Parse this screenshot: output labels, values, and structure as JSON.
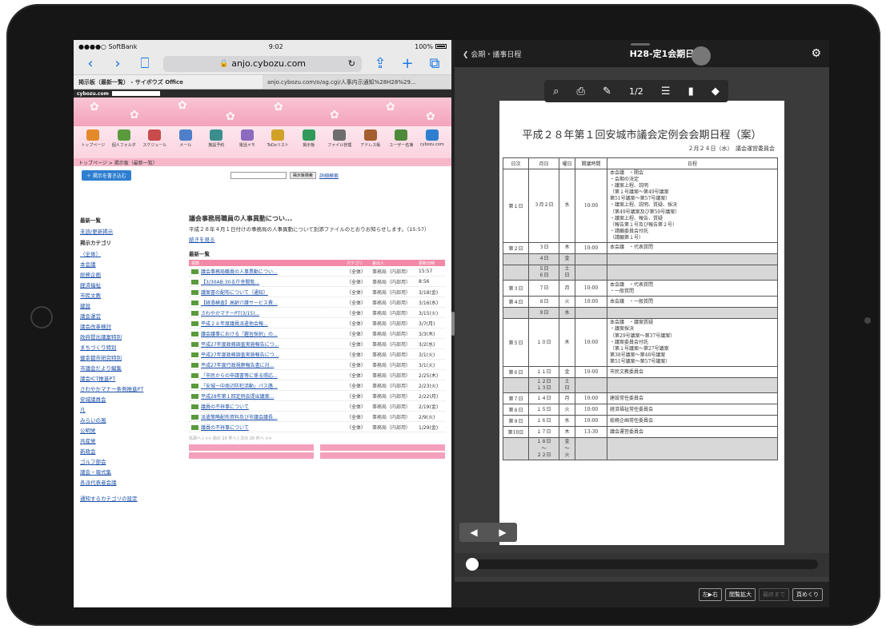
{
  "status": {
    "carrier": "●●●●○ SoftBank",
    "time": "9:02",
    "battery": "100%"
  },
  "safari": {
    "url": "anjo.cybozu.com",
    "tabs": [
      "掲示板（最新一覧） - サイボウズ Office",
      "anjo.cybozu.com/o/ag.cgi/人事内示通知%28H28%29..."
    ]
  },
  "cybozu": {
    "brand": "cybozu.com",
    "apps": [
      "トップページ",
      "個人フォルダ",
      "スケジュール",
      "メール",
      "施設予約",
      "電話メモ",
      "ToDoリスト",
      "掲示板",
      "ファイル管理",
      "アドレス帳",
      "ユーザー名簿",
      "cybozu.com"
    ],
    "breadcrumb": "トップページ > 掲示板（最新一覧）",
    "write_button": "＋ 掲示を書き込む",
    "search_button": "掲示板検索",
    "search_link": "詳細検索",
    "sidebar": {
      "head1": "最新一覧",
      "item1": "未読/更新掲示",
      "head2": "掲示カテゴリ",
      "items": [
        "（全体）",
        "本会議",
        "総務企画",
        "経済福祉",
        "市民文教",
        "建設",
        "議会運営",
        "議会改革検討",
        "政府提出議案特別",
        "まちづくり特別",
        "健幸都市研究特別",
        "市議会だより編集",
        "議会ICT推進PT",
        "さわやかマナー条例推進PT",
        "安城議員会",
        "凡",
        "みらいの風",
        "公明党",
        "共産党",
        "新政会",
        "ゴルフ部会",
        "議会・報式集",
        "各派代表者会議"
      ],
      "footer": "通知するカテゴリの設定"
    },
    "main": {
      "title": "議会事務局職員の人事異動につい...",
      "body": "平成２８年４月１日付けの事務局の人事異動について別添ファイルのとおりお知らせします。（15:57）",
      "more": "続きを見る",
      "list_title": "最新一覧",
      "headers": [
        "標題",
        "カテゴリ",
        "差出人",
        "更新日時"
      ],
      "rows": [
        {
          "t": "議会事務局職員の人事異動につい...",
          "c": "（全体）",
          "s": "事務局（内部用）",
          "d": "15:57"
        },
        {
          "t": "【3/30AB:30る庁舎閲覧...",
          "c": "（全体）",
          "s": "事務局（内部用）",
          "d": "8:56"
        },
        {
          "t": "議案書の配布について（通知）",
          "c": "（全体）",
          "s": "事務局（内部用）",
          "d": "3/18(金)"
        },
        {
          "t": "【経過検査】高齢介護サービス費...",
          "c": "（全体）",
          "s": "事務局（内部用）",
          "d": "3/16(水)"
        },
        {
          "t": "さわやかマナーPT(3/15)...",
          "c": "（全体）",
          "s": "事務局（内部用）",
          "d": "3/15(火)"
        },
        {
          "t": "平成２８年度議員派遣他会報...",
          "c": "（全体）",
          "s": "事務局（内部用）",
          "d": "3/7(月)"
        },
        {
          "t": "議会議事における「趣旨採択」の...",
          "c": "（全体）",
          "s": "事務局（内部用）",
          "d": "3/3(木)"
        },
        {
          "t": "平成27年度政務調査実施報告につ...",
          "c": "（全体）",
          "s": "事務局（内部用）",
          "d": "3/2(水)"
        },
        {
          "t": "平成27年度政務調査実施報告につ...",
          "c": "（全体）",
          "s": "事務局（内部用）",
          "d": "3/1(火)"
        },
        {
          "t": "平成27年度行政視察報告書に対...",
          "c": "（全体）",
          "s": "事務局（内部用）",
          "d": "3/1(火)"
        },
        {
          "t": "「市民からの申請書等に係る照応...",
          "c": "（全体）",
          "s": "事務局（内部用）",
          "d": "2/25(木)"
        },
        {
          "t": "「安城一中周辺防犯活動」パス路...",
          "c": "（全体）",
          "s": "事務局（内部用）",
          "d": "2/23(火)"
        },
        {
          "t": "平成28年第１回定例会提出議案...",
          "c": "（全体）",
          "s": "事務局（内部用）",
          "d": "2/22(月)"
        },
        {
          "t": "議員の不祥事について",
          "c": "（全体）",
          "s": "事務局（内部用）",
          "d": "2/19(金)"
        },
        {
          "t": "派遣策略配布資料及び市議会議長...",
          "c": "（全体）",
          "s": "事務局（内部用）",
          "d": "2/9(火)"
        },
        {
          "t": "議員の不祥事について",
          "c": "（全体）",
          "s": "事務局（内部用）",
          "d": "1/29(金)"
        }
      ],
      "pager": "先頭へ | << 前の 20 件へ | 次の 20 件へ >>"
    }
  },
  "viewer": {
    "back": "会期・議事日程",
    "title": "H28-定1会期日程",
    "page": "1/2",
    "doc_title": "平成２８年第１回安城市議会定例会会期日程（案）",
    "doc_date": "２月２４日（水）　議会運営委員会",
    "headers": [
      "日次",
      "月日",
      "曜日",
      "開議時間",
      "日程"
    ],
    "rows": [
      {
        "d": "第１日",
        "m": "３月２日",
        "w": "水",
        "t": "10:00",
        "n": "本会議　・開会\n・会期の決定\n・議案上程、説明\n（第１号議案～第49号議案\n第51号議案～第57号議案）\n・議案上程、説明、質疑、採決\n（第49号議案及び第50号議案）\n・議案上程、報告、質疑\n（報告第１号及び報告第２号）\n・請願委員会付託\n（請願第１号）",
        "g": false
      },
      {
        "d": "第２日",
        "m": "３日",
        "w": "木",
        "t": "10:00",
        "n": "本会議　・代表質問",
        "g": false
      },
      {
        "d": "",
        "m": "４日",
        "w": "金",
        "t": "",
        "n": "",
        "g": true
      },
      {
        "d": "",
        "m": "５日\n６日",
        "w": "土\n日",
        "t": "",
        "n": "",
        "g": true
      },
      {
        "d": "第３日",
        "m": "７日",
        "w": "月",
        "t": "10:00",
        "n": "本会議　・代表質問\n・一般質問",
        "g": false
      },
      {
        "d": "第４日",
        "m": "８日",
        "w": "火",
        "t": "10:00",
        "n": "本会議　・一般質問",
        "g": false
      },
      {
        "d": "",
        "m": "９日",
        "w": "水",
        "t": "",
        "n": "",
        "g": true
      },
      {
        "d": "第５日",
        "m": "１０日",
        "w": "木",
        "t": "10:00",
        "n": "本会議　・議案質疑\n・議案採決\n（第29号議案～第37号議案）\n・議案委員会付託\n（第１号議案～第27号議案\n第38号議案～第48号議案\n第51号議案～第57号議案）",
        "g": false
      },
      {
        "d": "第６日",
        "m": "１１日",
        "w": "金",
        "t": "10:00",
        "n": "市民文教委員会",
        "g": false
      },
      {
        "d": "",
        "m": "１２日\n１３日",
        "w": "土\n日",
        "t": "",
        "n": "",
        "g": true
      },
      {
        "d": "第７日",
        "m": "１４日",
        "w": "月",
        "t": "10:00",
        "n": "建設常任委員会",
        "g": false
      },
      {
        "d": "第８日",
        "m": "１５日",
        "w": "火",
        "t": "10:00",
        "n": "経済福祉常任委員会",
        "g": false
      },
      {
        "d": "第９日",
        "m": "１６日",
        "w": "水",
        "t": "10:00",
        "n": "総務企画常任委員会",
        "g": false
      },
      {
        "d": "第10日",
        "m": "１７日",
        "w": "木",
        "t": "13:30",
        "n": "議会運営委員会",
        "g": false
      },
      {
        "d": "",
        "m": "１８日\n～\n２２日",
        "w": "金\n～\n火",
        "t": "",
        "n": "",
        "g": true
      }
    ],
    "buttons": [
      "左▶右",
      "閲覧拡大",
      "最終まで",
      "頁めくり"
    ]
  }
}
